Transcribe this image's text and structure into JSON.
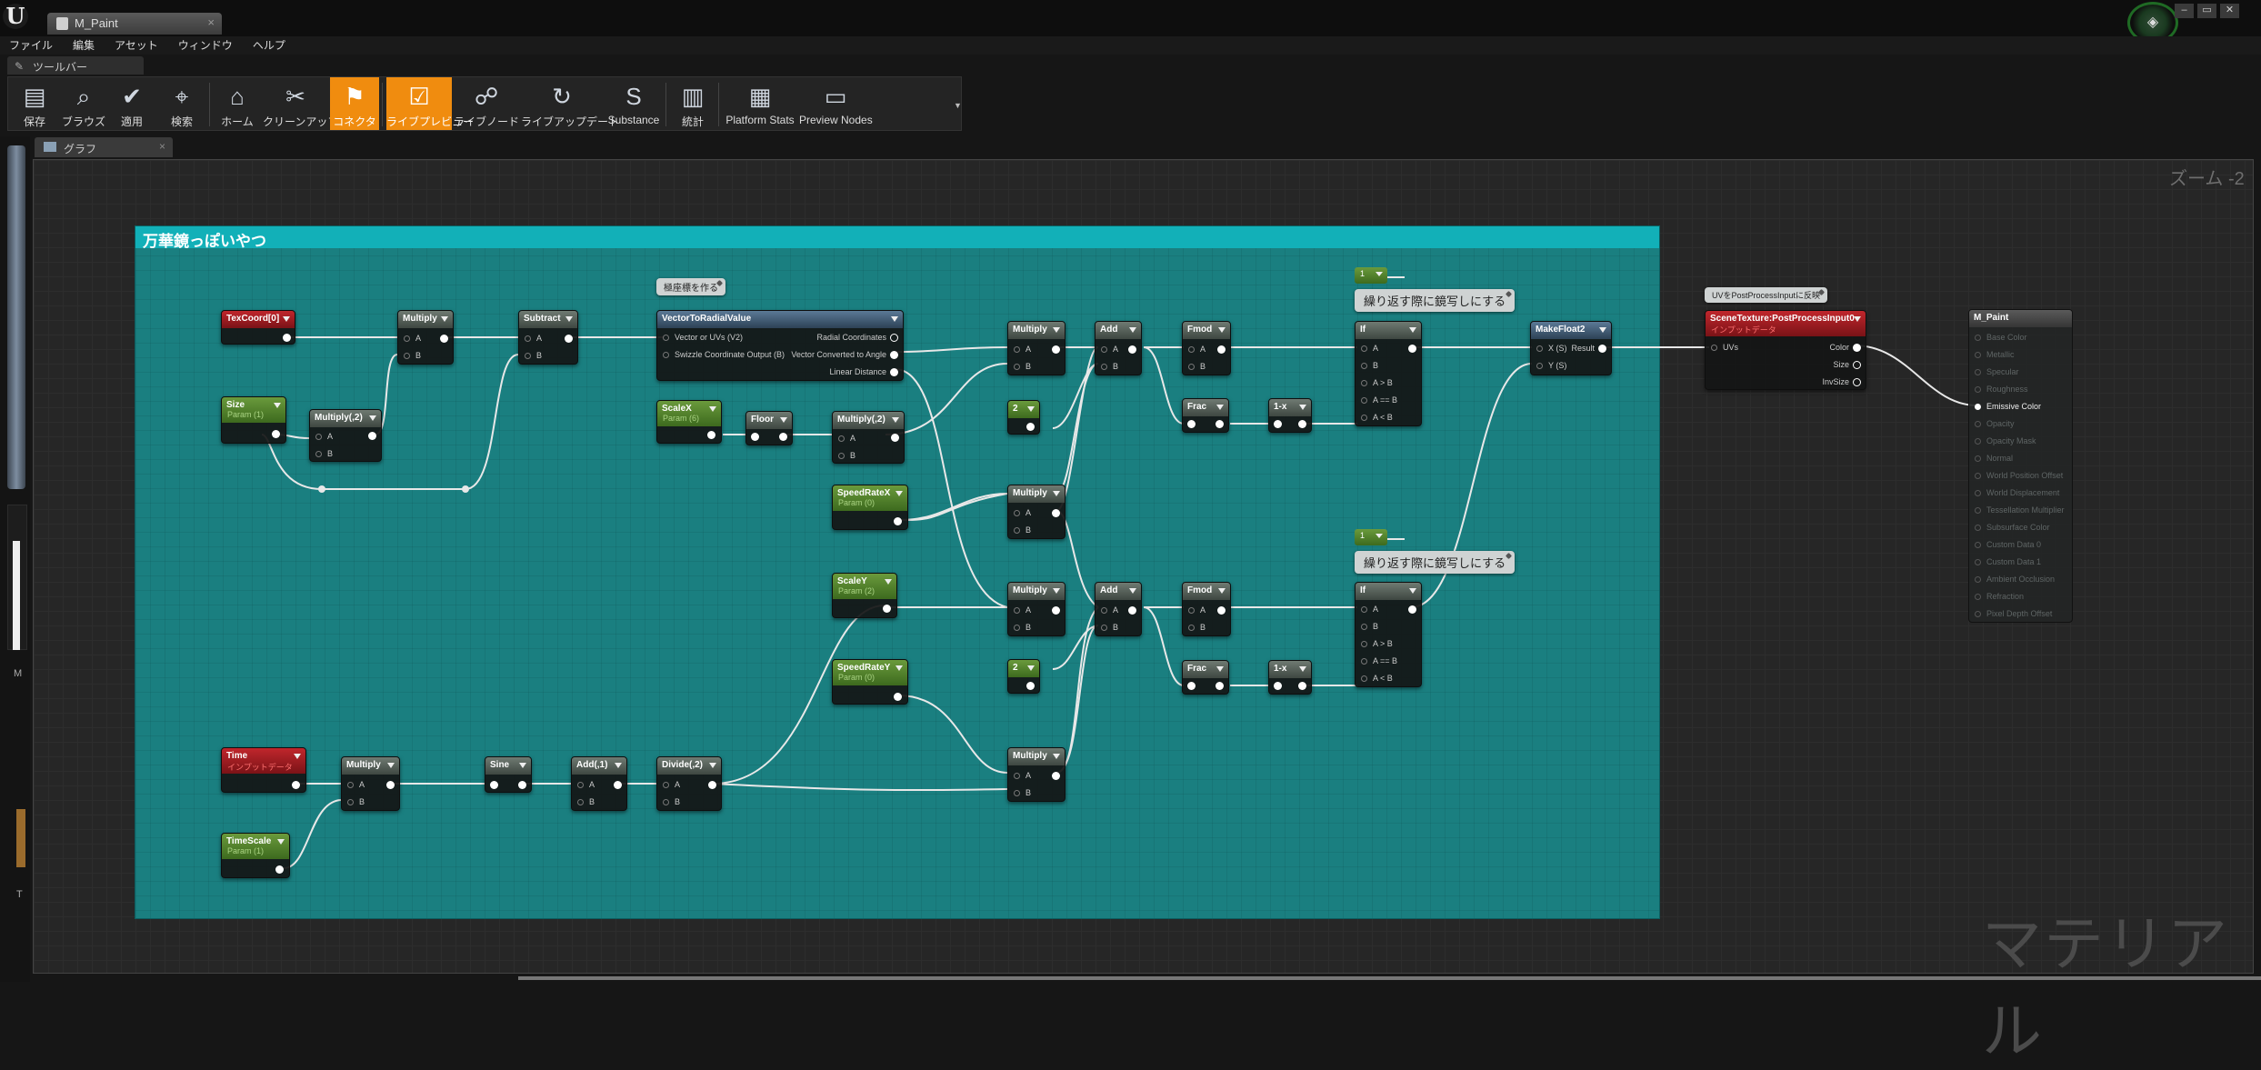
{
  "window": {
    "tab_title": "M_Paint",
    "menu": [
      "ファイル",
      "編集",
      "アセット",
      "ウィンドウ",
      "ヘルプ"
    ],
    "toolbar_tab": "ツールバー",
    "graph_tab": "グラフ",
    "zoom": "ズーム -2",
    "watermark": "マテリアル",
    "logo": "U"
  },
  "toolbar": [
    {
      "label": "保存",
      "icon": "save-icon",
      "glyph": "▤",
      "active": false
    },
    {
      "label": "ブラウズ",
      "icon": "browse-icon",
      "glyph": "⌕",
      "active": false
    },
    {
      "label": "適用",
      "icon": "apply-icon",
      "glyph": "✔",
      "active": false
    },
    {
      "label": "検索",
      "icon": "search-icon",
      "glyph": "⌖",
      "active": false
    },
    {
      "label": "ホーム",
      "icon": "home-icon",
      "glyph": "⌂",
      "active": false
    },
    {
      "label": "クリーンアップ",
      "icon": "cleanup-icon",
      "glyph": "✂",
      "active": false
    },
    {
      "label": "コネクタ",
      "icon": "connector-icon",
      "glyph": "⚑",
      "active": true
    },
    {
      "label": "ライブプレビュー",
      "icon": "live-preview-icon",
      "glyph": "☑",
      "active": true
    },
    {
      "label": "ライブノード",
      "icon": "live-nodes-icon",
      "glyph": "☍",
      "active": false
    },
    {
      "label": "ライブアップデート",
      "icon": "live-update-icon",
      "glyph": "↻",
      "active": false
    },
    {
      "label": "Substance",
      "icon": "substance-icon",
      "glyph": "S",
      "active": false
    },
    {
      "label": "統計",
      "icon": "stats-icon",
      "glyph": "▥",
      "active": false
    },
    {
      "label": "Platform Stats",
      "icon": "platform-stats-icon",
      "glyph": "▦",
      "active": false
    },
    {
      "label": "Preview Nodes",
      "icon": "preview-nodes-icon",
      "glyph": "▭",
      "active": false
    }
  ],
  "comment": {
    "title": "万華鏡っぽいやつ",
    "bubbles": [
      "極座標を作る",
      "繰り返す際に鏡写しにする",
      "繰り返す際に鏡写しにする",
      "UVをPostProcessInputに反映"
    ]
  },
  "nodes": {
    "texcoord": {
      "title": "TexCoord[0]"
    },
    "multiply1": {
      "title": "Multiply",
      "a": "A",
      "b": "B"
    },
    "subtract": {
      "title": "Subtract",
      "a": "A",
      "b": "B"
    },
    "size": {
      "title": "Size",
      "sub": "Param (1)"
    },
    "multiply_n2": {
      "title": "Multiply(,2)",
      "a": "A",
      "b": "B"
    },
    "vtrv": {
      "title": "VectorToRadialValue",
      "in1": "Vector or UVs (V2)",
      "in2": "Swizzle Coordinate Output (B)",
      "out1": "Radial Coordinates",
      "out2": "Vector Converted to Angle",
      "out3": "Linear Distance"
    },
    "scalex": {
      "title": "ScaleX",
      "sub": "Param (6)"
    },
    "floor": {
      "title": "Floor"
    },
    "multiply_n2b": {
      "title": "Multiply(,2)",
      "a": "A",
      "b": "B"
    },
    "speedratex": {
      "title": "SpeedRateX",
      "sub": "Param (0)"
    },
    "scaley": {
      "title": "ScaleY",
      "sub": "Param (2)"
    },
    "speedratey": {
      "title": "SpeedRateY",
      "sub": "Param (0)"
    },
    "time": {
      "title": "Time",
      "sub": "インプットデータ"
    },
    "timescale": {
      "title": "TimeScale",
      "sub": "Param (1)"
    },
    "multiply_t": {
      "title": "Multiply",
      "a": "A",
      "b": "B"
    },
    "sine": {
      "title": "Sine"
    },
    "add1": {
      "title": "Add(,1)",
      "a": "A",
      "b": "B"
    },
    "divide2": {
      "title": "Divide(,2)",
      "a": "A",
      "b": "B"
    },
    "mul_top": {
      "title": "Multiply",
      "a": "A",
      "b": "B"
    },
    "two_top": {
      "title": "2"
    },
    "mul_sx": {
      "title": "Multiply",
      "a": "A",
      "b": "B"
    },
    "mul_mid": {
      "title": "Multiply",
      "a": "A",
      "b": "B"
    },
    "two_bot": {
      "title": "2"
    },
    "mul_bot": {
      "title": "Multiply",
      "a": "A",
      "b": "B"
    },
    "add_top": {
      "title": "Add",
      "a": "A",
      "b": "B"
    },
    "add_bot": {
      "title": "Add",
      "a": "A",
      "b": "B"
    },
    "fmod_top": {
      "title": "Fmod",
      "a": "A",
      "b": "B"
    },
    "fmod_bot": {
      "title": "Fmod",
      "a": "A",
      "b": "B"
    },
    "frac_top": {
      "title": "Frac"
    },
    "frac_bot": {
      "title": "Frac"
    },
    "oneminus_top": {
      "title": "1-x"
    },
    "oneminus_bot": {
      "title": "1-x"
    },
    "one_top": {
      "title": "1"
    },
    "one_bot": {
      "title": "1"
    },
    "if_top": {
      "title": "If",
      "a": "A",
      "b": "B",
      "gt": "A > B",
      "eq": "A == B",
      "lt": "A < B"
    },
    "if_bot": {
      "title": "If",
      "a": "A",
      "b": "B",
      "gt": "A > B",
      "eq": "A == B",
      "lt": "A < B"
    },
    "makefloat2": {
      "title": "MakeFloat2",
      "x": "X (S)",
      "y": "Y (S)",
      "result": "Result"
    },
    "scenetex": {
      "title": "SceneTexture:PostProcessInput0",
      "sub": "インプットデータ",
      "uvs": "UVs",
      "color": "Color",
      "size": "Size",
      "invsize": "InvSize"
    }
  },
  "result": {
    "title": "M_Paint",
    "inputs": [
      "Base Color",
      "Metallic",
      "Specular",
      "Roughness",
      "Emissive Color",
      "Opacity",
      "Opacity Mask",
      "Normal",
      "World Position Offset",
      "World Displacement",
      "Tessellation Multiplier",
      "Subsurface Color",
      "Custom Data 0",
      "Custom Data 1",
      "Ambient Occlusion",
      "Refraction",
      "Pixel Depth Offset"
    ],
    "active_input": "Emissive Color"
  }
}
